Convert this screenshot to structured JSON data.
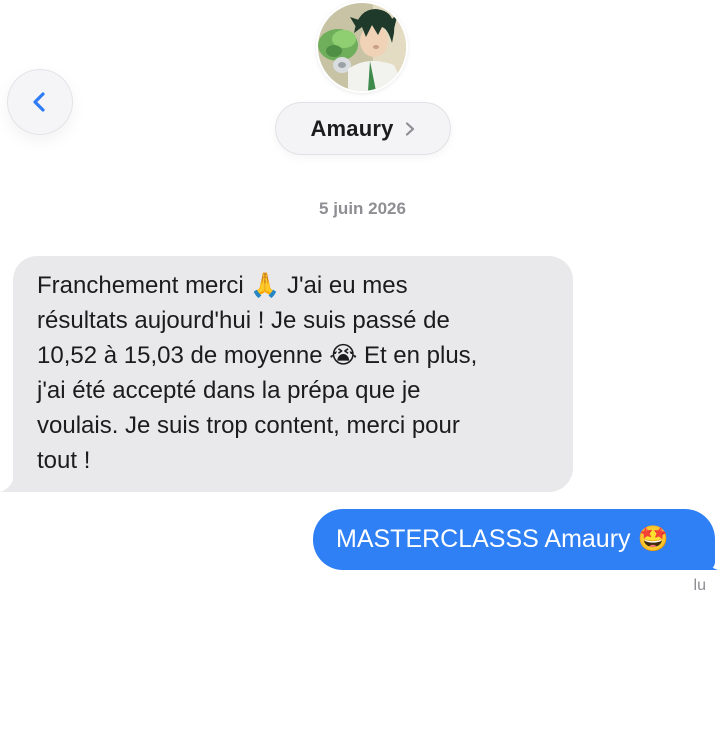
{
  "header": {
    "back_icon": "chevron-left-icon",
    "contact_name": "Amaury",
    "contact_chevron_icon": "chevron-right-icon",
    "avatar_icon": "anime-character-avatar"
  },
  "conversation": {
    "date": "5 juin 2026",
    "messages": [
      {
        "direction": "incoming",
        "text": "Franchement merci 🙏 J'ai eu mes\nrésultats aujourd'hui ! Je suis passé de\n10,52 à 15,03 de moyenne 😭 Et en plus,\nj'ai été accepté dans la prépa que je\nvoulais. Je suis trop content, merci pour\ntout !"
      },
      {
        "direction": "outgoing",
        "text": "MASTERCLASSS Amaury 🤩"
      }
    ],
    "read_receipt": "lu"
  },
  "colors": {
    "outgoing_bubble": "#2f80f5",
    "incoming_bubble": "#e9e9eb",
    "accent": "#2f7cf6",
    "muted_text": "#8e8e93"
  }
}
